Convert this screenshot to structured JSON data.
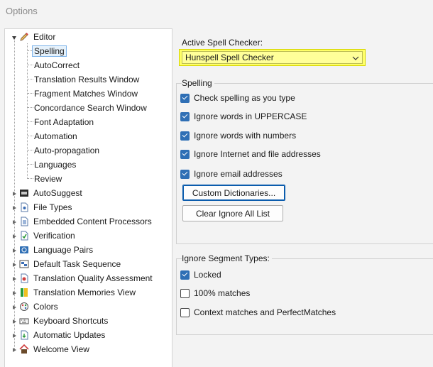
{
  "window": {
    "title": "Options"
  },
  "tree": {
    "editor": {
      "label": "Editor",
      "icon": "pencil-icon"
    },
    "editor_children": [
      {
        "label": "Spelling",
        "selected": true
      },
      {
        "label": "AutoCorrect"
      },
      {
        "label": "Translation Results Window"
      },
      {
        "label": "Fragment Matches Window"
      },
      {
        "label": "Concordance Search Window"
      },
      {
        "label": "Font Adaptation"
      },
      {
        "label": "Automation"
      },
      {
        "label": "Auto-propagation"
      },
      {
        "label": "Languages"
      },
      {
        "label": "Review"
      }
    ],
    "top_nodes": [
      {
        "label": "AutoSuggest",
        "icon": "autosuggest-icon"
      },
      {
        "label": "File Types",
        "icon": "file-types-icon"
      },
      {
        "label": "Embedded Content Processors",
        "icon": "embedded-content-icon"
      },
      {
        "label": "Verification",
        "icon": "verification-icon"
      },
      {
        "label": "Language Pairs",
        "icon": "language-pairs-icon"
      },
      {
        "label": "Default Task Sequence",
        "icon": "task-sequence-icon"
      },
      {
        "label": "Translation Quality Assessment",
        "icon": "quality-assessment-icon"
      },
      {
        "label": "Translation Memories View",
        "icon": "translation-memories-icon"
      },
      {
        "label": "Colors",
        "icon": "palette-icon"
      },
      {
        "label": "Keyboard Shortcuts",
        "icon": "keyboard-icon"
      },
      {
        "label": "Automatic Updates",
        "icon": "updates-icon"
      },
      {
        "label": "Welcome View",
        "icon": "home-icon"
      }
    ]
  },
  "spell": {
    "active_label": "Active Spell Checker:",
    "selected": "Hunspell Spell Checker",
    "highlight_color": "#ffff66"
  },
  "spelling_group": {
    "title": "Spelling",
    "options": [
      {
        "label": "Check spelling as you type",
        "checked": true
      },
      {
        "label": "Ignore words in UPPERCASE",
        "checked": true
      },
      {
        "label": "Ignore words with numbers",
        "checked": true
      },
      {
        "label": "Ignore Internet and file addresses",
        "checked": true
      },
      {
        "label": "Ignore email addresses",
        "checked": true
      }
    ],
    "custom_dict_button": "Custom Dictionaries...",
    "clear_ignore_button": "Clear Ignore All List"
  },
  "ignore_group": {
    "title": "Ignore Segment Types:",
    "options": [
      {
        "label": "Locked",
        "checked": true
      },
      {
        "label": "100% matches",
        "checked": false
      },
      {
        "label": "Context matches and PerfectMatches",
        "checked": false
      }
    ]
  },
  "colors": {
    "accent": "#2f6fb5",
    "selection": "#e5f1fb"
  }
}
